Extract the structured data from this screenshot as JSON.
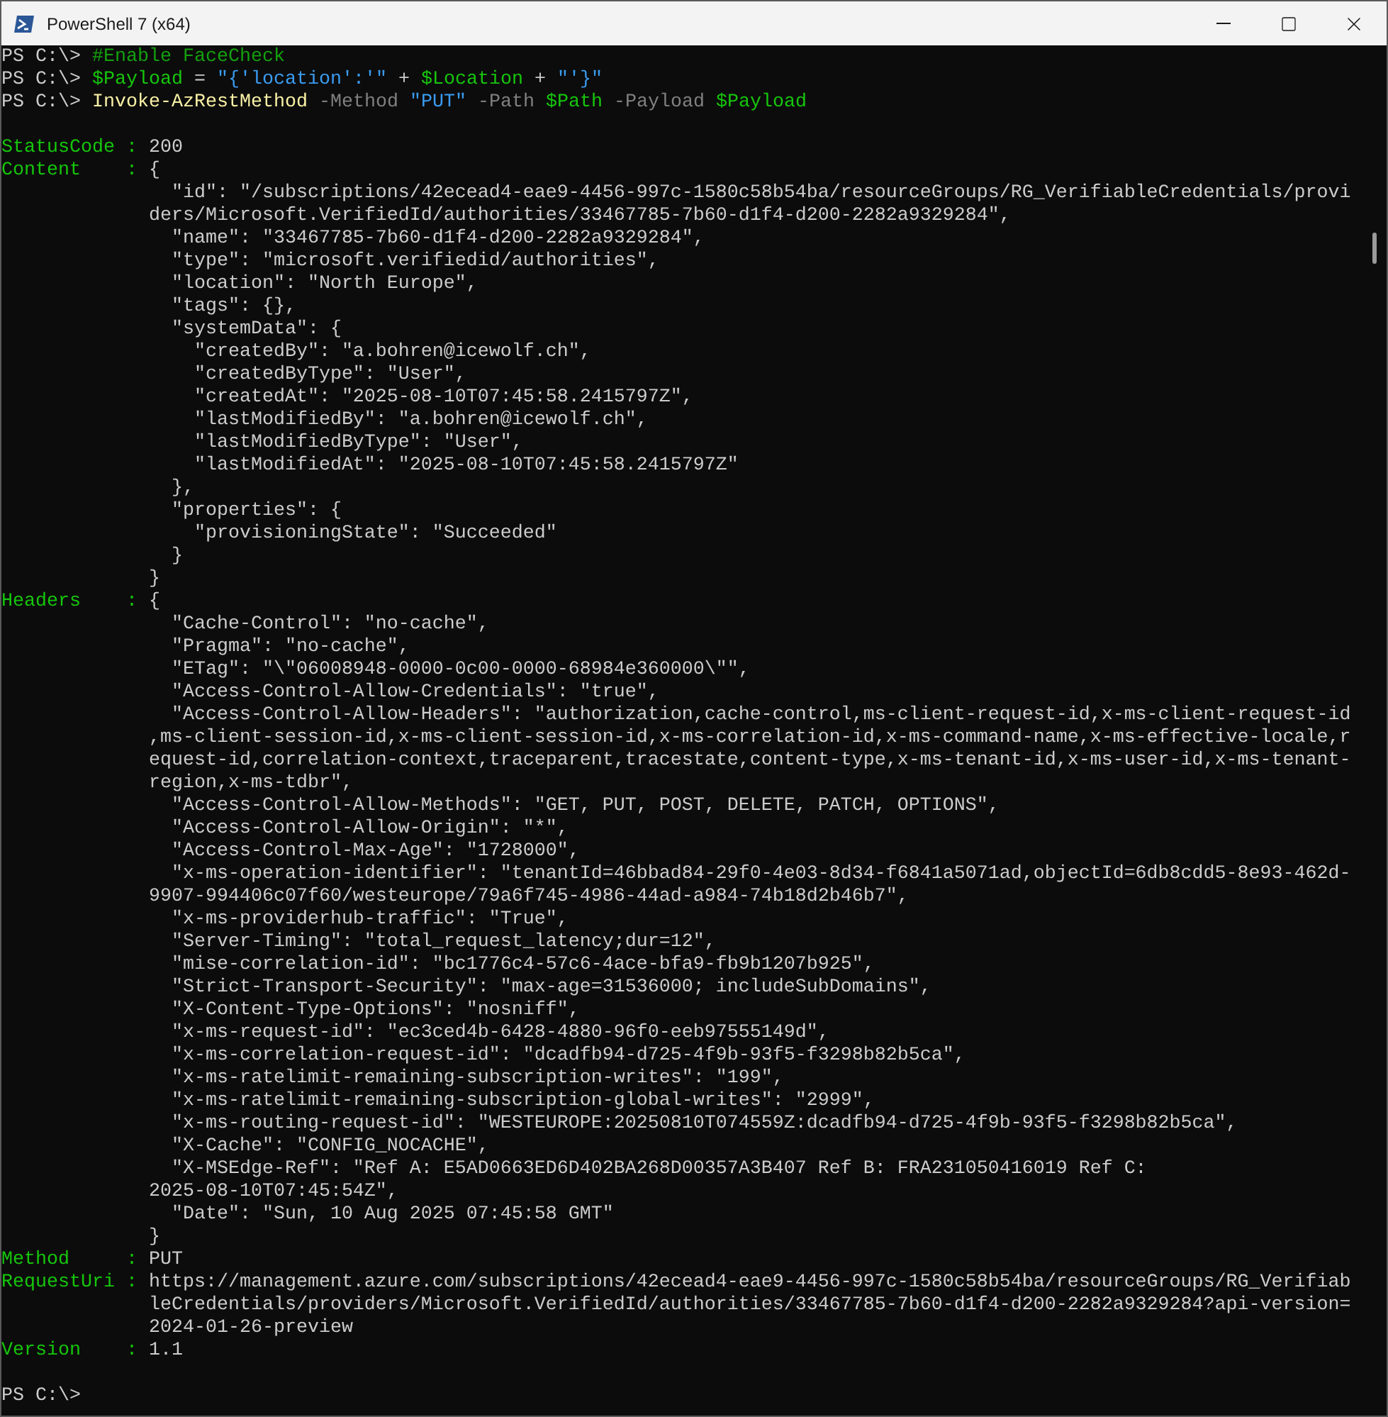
{
  "window": {
    "title": "PowerShell 7 (x64)"
  },
  "rows": [
    {
      "kind": "command",
      "segments": [
        {
          "kind": "prompt",
          "text": "PS C:\\>"
        },
        {
          "kind": "comment",
          "text": " #Enable FaceCheck"
        }
      ]
    },
    {
      "kind": "command",
      "segments": [
        {
          "kind": "prompt",
          "text": "PS C:\\>"
        },
        {
          "kind": "variable",
          "text": " $Payload"
        },
        {
          "kind": "operator",
          "text": " ="
        },
        {
          "kind": "string",
          "text": " \"{'location':'\""
        },
        {
          "kind": "operator",
          "text": " +"
        },
        {
          "kind": "variable",
          "text": " $Location"
        },
        {
          "kind": "operator",
          "text": " +"
        },
        {
          "kind": "string",
          "text": " \"'}\""
        }
      ]
    },
    {
      "kind": "command",
      "segments": [
        {
          "kind": "prompt",
          "text": "PS C:\\>"
        },
        {
          "kind": "cmdlet",
          "text": " Invoke-AzRestMethod"
        },
        {
          "kind": "parameter",
          "text": " -Method"
        },
        {
          "kind": "string",
          "text": " \"PUT\""
        },
        {
          "kind": "parameter",
          "text": " -Path"
        },
        {
          "kind": "variable",
          "text": " $Path"
        },
        {
          "kind": "parameter",
          "text": " -Payload"
        },
        {
          "kind": "variable",
          "text": " $Payload"
        }
      ]
    },
    {
      "kind": "blank"
    },
    {
      "kind": "field",
      "label": "StatusCode :",
      "value": "200"
    },
    {
      "kind": "field",
      "label": "Content    :",
      "value": "{"
    },
    {
      "kind": "body",
      "text": "  \"id\": \"/subscriptions/42ecead4-eae9-4456-997c-1580c58b54ba/resourceGroups/RG_VerifiableCredentials/provi"
    },
    {
      "kind": "body",
      "text": "ders/Microsoft.VerifiedId/authorities/33467785-7b60-d1f4-d200-2282a9329284\","
    },
    {
      "kind": "body",
      "text": "  \"name\": \"33467785-7b60-d1f4-d200-2282a9329284\","
    },
    {
      "kind": "body",
      "text": "  \"type\": \"microsoft.verifiedid/authorities\","
    },
    {
      "kind": "body",
      "text": "  \"location\": \"North Europe\","
    },
    {
      "kind": "body",
      "text": "  \"tags\": {},"
    },
    {
      "kind": "body",
      "text": "  \"systemData\": {"
    },
    {
      "kind": "body",
      "text": "    \"createdBy\": \"a.bohren@icewolf.ch\","
    },
    {
      "kind": "body",
      "text": "    \"createdByType\": \"User\","
    },
    {
      "kind": "body",
      "text": "    \"createdAt\": \"2025-08-10T07:45:58.2415797Z\","
    },
    {
      "kind": "body",
      "text": "    \"lastModifiedBy\": \"a.bohren@icewolf.ch\","
    },
    {
      "kind": "body",
      "text": "    \"lastModifiedByType\": \"User\","
    },
    {
      "kind": "body",
      "text": "    \"lastModifiedAt\": \"2025-08-10T07:45:58.2415797Z\""
    },
    {
      "kind": "body",
      "text": "  },"
    },
    {
      "kind": "body",
      "text": "  \"properties\": {"
    },
    {
      "kind": "body",
      "text": "    \"provisioningState\": \"Succeeded\""
    },
    {
      "kind": "body",
      "text": "  }"
    },
    {
      "kind": "body",
      "text": "}"
    },
    {
      "kind": "field",
      "label": "Headers    :",
      "value": "{"
    },
    {
      "kind": "body",
      "text": "  \"Cache-Control\": \"no-cache\","
    },
    {
      "kind": "body",
      "text": "  \"Pragma\": \"no-cache\","
    },
    {
      "kind": "body",
      "text": "  \"ETag\": \"\\\"06008948-0000-0c00-0000-68984e360000\\\"\","
    },
    {
      "kind": "body",
      "text": "  \"Access-Control-Allow-Credentials\": \"true\","
    },
    {
      "kind": "body",
      "text": "  \"Access-Control-Allow-Headers\": \"authorization,cache-control,ms-client-request-id,x-ms-client-request-id"
    },
    {
      "kind": "body",
      "text": ",ms-client-session-id,x-ms-client-session-id,x-ms-correlation-id,x-ms-command-name,x-ms-effective-locale,r"
    },
    {
      "kind": "body",
      "text": "equest-id,correlation-context,traceparent,tracestate,content-type,x-ms-tenant-id,x-ms-user-id,x-ms-tenant-"
    },
    {
      "kind": "body",
      "text": "region,x-ms-tdbr\","
    },
    {
      "kind": "body",
      "text": "  \"Access-Control-Allow-Methods\": \"GET, PUT, POST, DELETE, PATCH, OPTIONS\","
    },
    {
      "kind": "body",
      "text": "  \"Access-Control-Allow-Origin\": \"*\","
    },
    {
      "kind": "body",
      "text": "  \"Access-Control-Max-Age\": \"1728000\","
    },
    {
      "kind": "body",
      "text": "  \"x-ms-operation-identifier\": \"tenantId=46bbad84-29f0-4e03-8d34-f6841a5071ad,objectId=6db8cdd5-8e93-462d-"
    },
    {
      "kind": "body",
      "text": "9907-994406c07f60/westeurope/79a6f745-4986-44ad-a984-74b18d2b46b7\","
    },
    {
      "kind": "body",
      "text": "  \"x-ms-providerhub-traffic\": \"True\","
    },
    {
      "kind": "body",
      "text": "  \"Server-Timing\": \"total_request_latency;dur=12\","
    },
    {
      "kind": "body",
      "text": "  \"mise-correlation-id\": \"bc1776c4-57c6-4ace-bfa9-fb9b1207b925\","
    },
    {
      "kind": "body",
      "text": "  \"Strict-Transport-Security\": \"max-age=31536000; includeSubDomains\","
    },
    {
      "kind": "body",
      "text": "  \"X-Content-Type-Options\": \"nosniff\","
    },
    {
      "kind": "body",
      "text": "  \"x-ms-request-id\": \"ec3ced4b-6428-4880-96f0-eeb97555149d\","
    },
    {
      "kind": "body",
      "text": "  \"x-ms-correlation-request-id\": \"dcadfb94-d725-4f9b-93f5-f3298b82b5ca\","
    },
    {
      "kind": "body",
      "text": "  \"x-ms-ratelimit-remaining-subscription-writes\": \"199\","
    },
    {
      "kind": "body",
      "text": "  \"x-ms-ratelimit-remaining-subscription-global-writes\": \"2999\","
    },
    {
      "kind": "body",
      "text": "  \"x-ms-routing-request-id\": \"WESTEUROPE:20250810T074559Z:dcadfb94-d725-4f9b-93f5-f3298b82b5ca\","
    },
    {
      "kind": "body",
      "text": "  \"X-Cache\": \"CONFIG_NOCACHE\","
    },
    {
      "kind": "body",
      "text": "  \"X-MSEdge-Ref\": \"Ref A: E5AD0663ED6D402BA268D00357A3B407 Ref B: FRA231050416019 Ref C:"
    },
    {
      "kind": "body",
      "text": "2025-08-10T07:45:54Z\","
    },
    {
      "kind": "body",
      "text": "  \"Date\": \"Sun, 10 Aug 2025 07:45:58 GMT\""
    },
    {
      "kind": "body",
      "text": "}"
    },
    {
      "kind": "field",
      "label": "Method     :",
      "value": "PUT"
    },
    {
      "kind": "field",
      "label": "RequestUri :",
      "value": "https://management.azure.com/subscriptions/42ecead4-eae9-4456-997c-1580c58b54ba/resourceGroups/RG_Verifiab"
    },
    {
      "kind": "body",
      "text": "leCredentials/providers/Microsoft.VerifiedId/authorities/33467785-7b60-d1f4-d200-2282a9329284?api-version="
    },
    {
      "kind": "body",
      "text": "2024-01-26-preview"
    },
    {
      "kind": "field",
      "label": "Version    :",
      "value": "1.1"
    },
    {
      "kind": "blank"
    },
    {
      "kind": "command",
      "segments": [
        {
          "kind": "prompt",
          "text": "PS C:\\>"
        }
      ]
    }
  ]
}
